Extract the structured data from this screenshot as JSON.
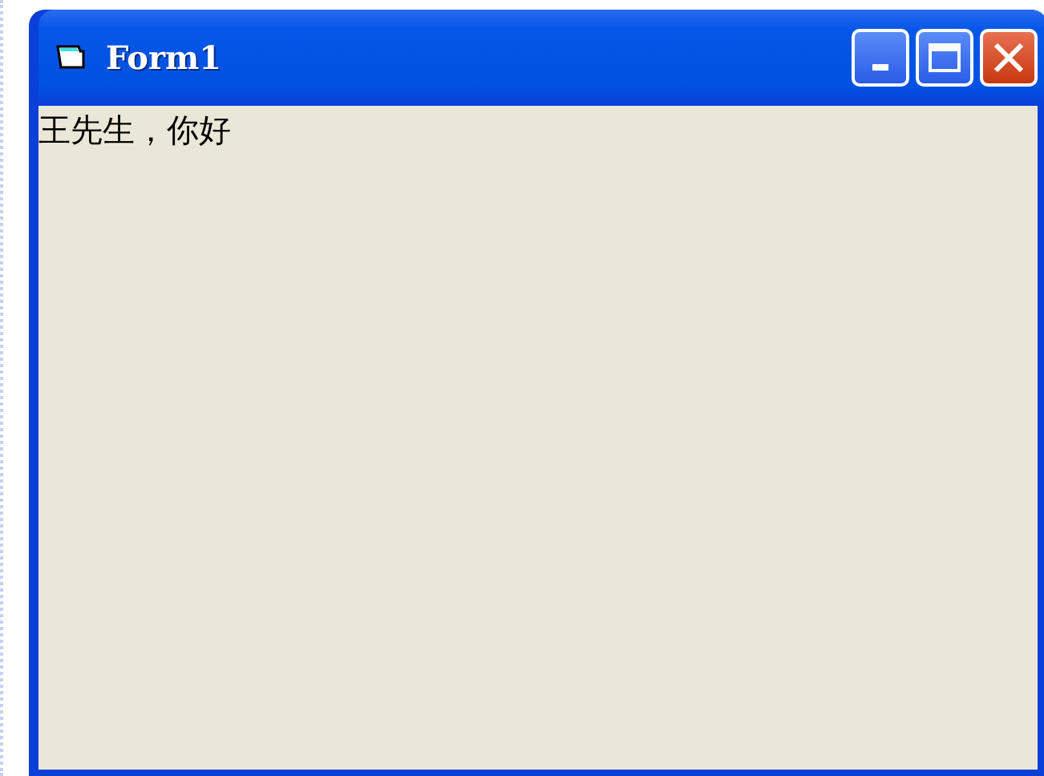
{
  "window": {
    "title": "Form1"
  },
  "label": {
    "text": "王先生，你好"
  }
}
